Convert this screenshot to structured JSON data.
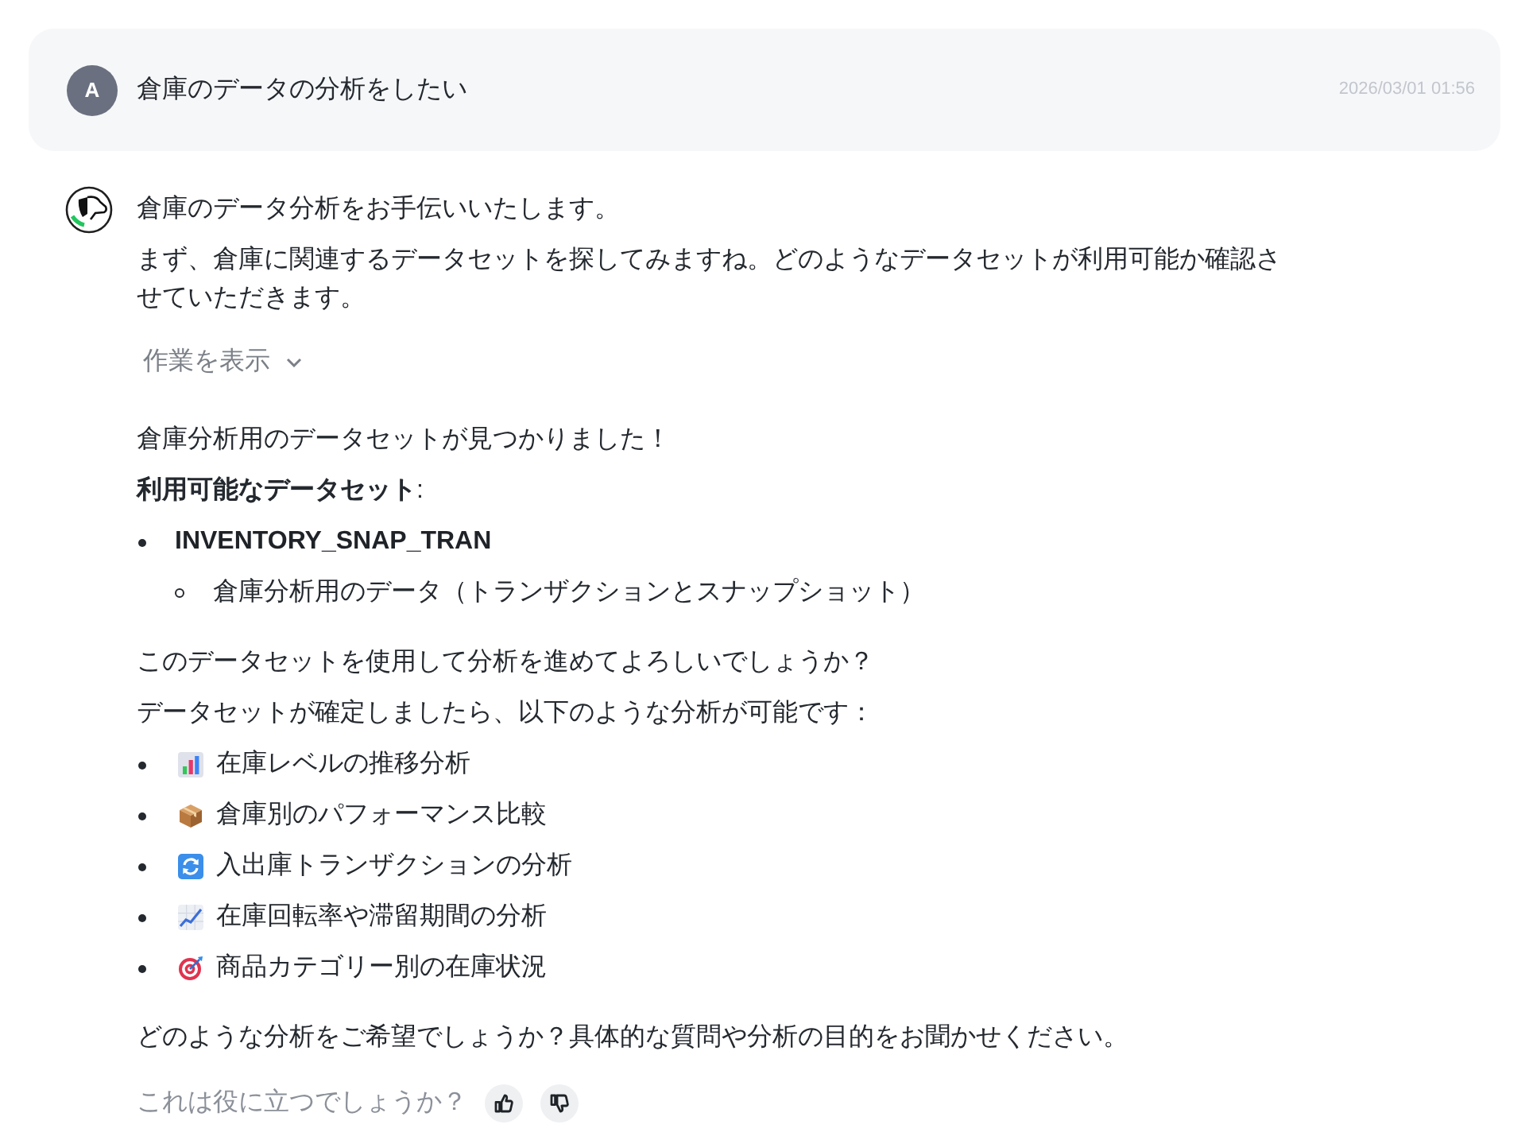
{
  "user_message": {
    "avatar": "A",
    "text": "倉庫のデータの分析をしたい",
    "timestamp": "2026/03/01 01:56"
  },
  "assistant_message": {
    "blocks": [
      {
        "kind": "paragraph",
        "text": "倉庫のデータ分析をお手伝いいたします。"
      },
      {
        "kind": "paragraph",
        "text": "まず、倉庫に関連するデータセットを探してみますね。どのようなデータセットが利用可能か確認させていただきます。"
      },
      {
        "kind": "toggle",
        "label": "作業を表示",
        "expanded": false
      },
      {
        "kind": "paragraph",
        "text": "倉庫分析用のデータセットが見つかりました！"
      },
      {
        "kind": "paragraph",
        "text": "**利用可能なデータセット**:"
      },
      {
        "kind": "list",
        "items": [
          {
            "text": "INVENTORY_SNAP_TRAN",
            "strong": true,
            "children": [
              {
                "text": "倉庫分析用のデータ（トランザクションとスナップショット）",
                "strong": false
              }
            ]
          }
        ]
      },
      {
        "kind": "paragraph",
        "text": "このデータセットを使用して分析を進めてよろしいでしょうか？"
      },
      {
        "kind": "paragraph",
        "text": "データセットが確定しましたら、以下のような分析が可能です："
      },
      {
        "kind": "list",
        "items": [
          {
            "kind": "bar-chart",
            "text": "在庫レベルの推移分析",
            "strong": false
          },
          {
            "kind": "package",
            "text": "倉庫別のパフォーマンス比較",
            "strong": false
          },
          {
            "kind": "sync",
            "text": "入出庫トランザクションの分析",
            "strong": false
          },
          {
            "kind": "line-chart",
            "text": "在庫回転率や滞留期間の分析",
            "strong": false
          },
          {
            "kind": "target",
            "text": "商品カテゴリー別の在庫状況",
            "strong": false
          }
        ]
      },
      {
        "kind": "paragraph",
        "text": "どのような分析をご希望でしょうか？具体的な質問や分析の目的をお聞かせください。"
      }
    ],
    "feedback": {
      "prompt": "これは役に立つでしょうか？"
    }
  }
}
